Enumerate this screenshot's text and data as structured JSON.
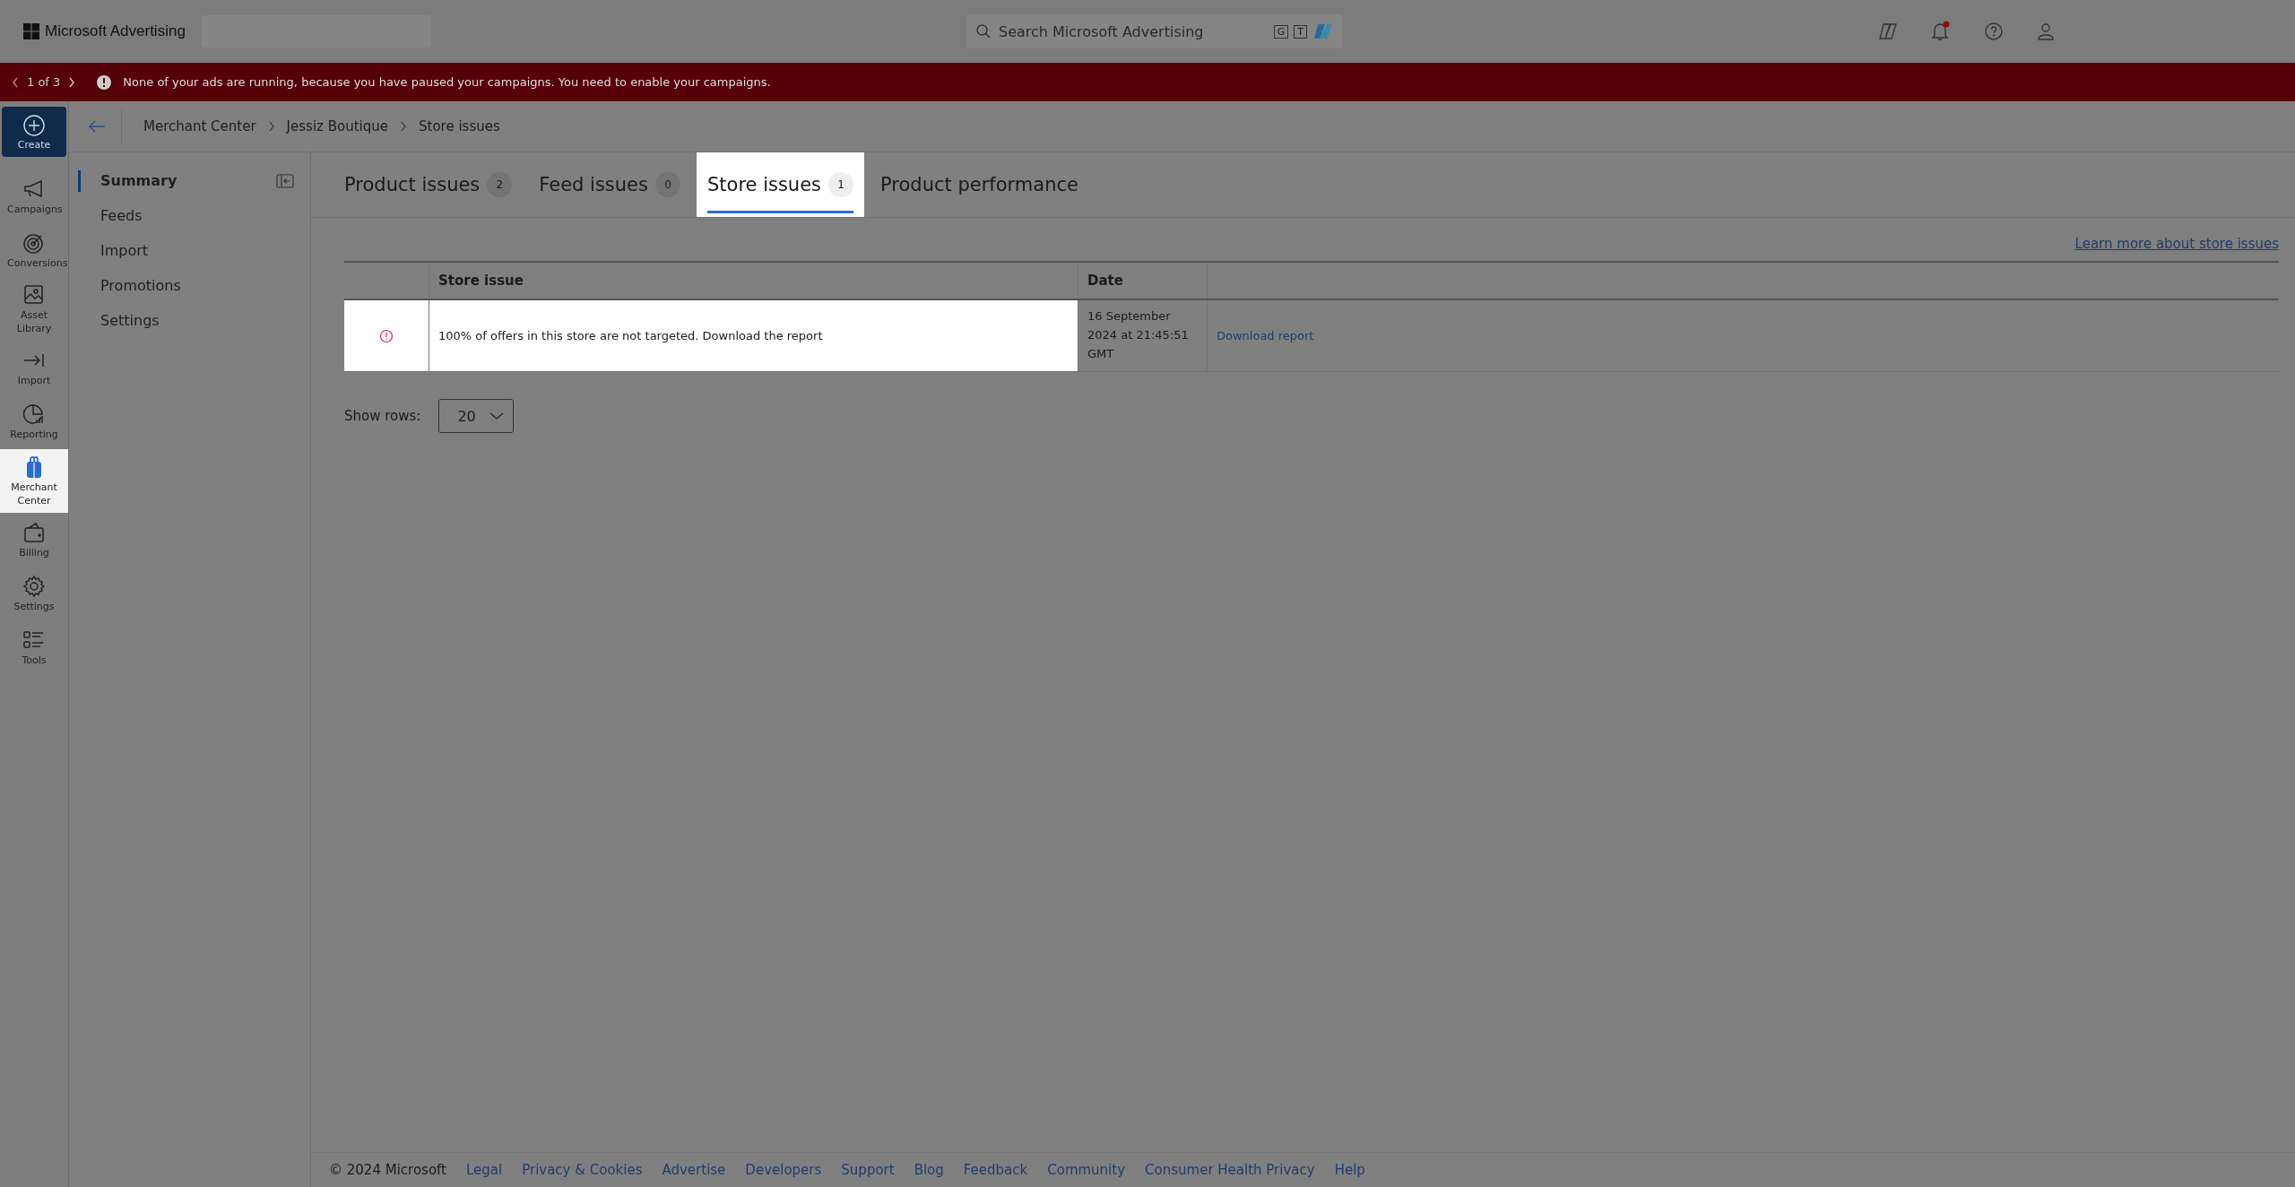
{
  "app": {
    "name": "Microsoft Advertising"
  },
  "search": {
    "placeholder": "Search Microsoft Advertising",
    "keys": [
      "G",
      "T"
    ]
  },
  "banner": {
    "pager": "1 of 3",
    "message": "None of your ads are running, because you have paused your campaigns. You need to enable your campaigns."
  },
  "breadcrumb": [
    "Merchant Center",
    "Jessiz Boutique",
    "Store issues"
  ],
  "nav_rail": [
    {
      "label": "Create",
      "kind": "create",
      "selected": false
    },
    {
      "label": "Campaigns",
      "kind": "item",
      "selected": false
    },
    {
      "label": "Conversions",
      "kind": "item",
      "selected": false
    },
    {
      "label": "Asset Library",
      "kind": "item",
      "selected": false
    },
    {
      "label": "Import",
      "kind": "item",
      "selected": false
    },
    {
      "label": "Reporting",
      "kind": "item",
      "selected": false
    },
    {
      "label": "Merchant Center",
      "kind": "item",
      "selected": true
    },
    {
      "label": "Billing",
      "kind": "item",
      "selected": false
    },
    {
      "label": "Settings",
      "kind": "item",
      "selected": false
    },
    {
      "label": "Tools",
      "kind": "item",
      "selected": false
    }
  ],
  "sidebar": {
    "items": [
      {
        "label": "Summary",
        "selected": true
      },
      {
        "label": "Feeds",
        "selected": false
      },
      {
        "label": "Import",
        "selected": false
      },
      {
        "label": "Promotions",
        "selected": false
      },
      {
        "label": "Settings",
        "selected": false
      }
    ]
  },
  "tabs": [
    {
      "label": "Product issues",
      "count": "2",
      "selected": false
    },
    {
      "label": "Feed issues",
      "count": "0",
      "selected": false
    },
    {
      "label": "Store issues",
      "count": "1",
      "selected": true
    },
    {
      "label": "Product performance",
      "selected": false
    }
  ],
  "learn_more": "Learn more about store issues",
  "table": {
    "columns": [
      "Store issue",
      "Date"
    ],
    "rows": [
      {
        "highlighted": true,
        "issue": "100% of offers in this store are not targeted. Download the report",
        "date": "16 September 2024 at 21:45:51 GMT",
        "action": "Download report"
      }
    ]
  },
  "show_rows": {
    "label": "Show rows:",
    "value": "20"
  },
  "footer": {
    "copyright": "© 2024 Microsoft",
    "links": [
      "Legal",
      "Privacy & Cookies",
      "Advertise",
      "Developers",
      "Support",
      "Blog",
      "Feedback",
      "Community",
      "Consumer Health Privacy",
      "Help"
    ]
  }
}
